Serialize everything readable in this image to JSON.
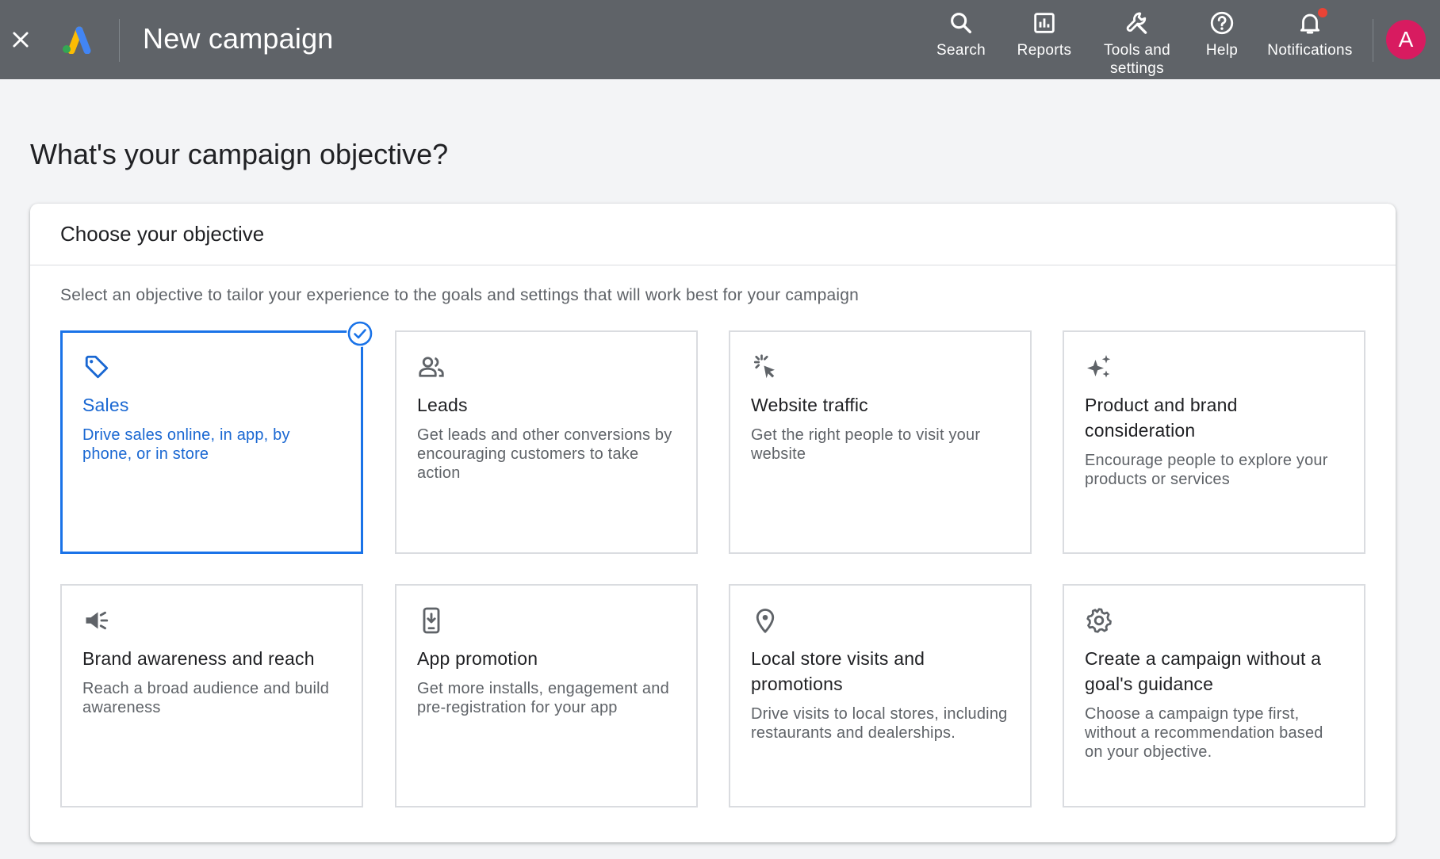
{
  "header": {
    "title": "New campaign",
    "nav": [
      {
        "label": "Search",
        "icon": "search-icon"
      },
      {
        "label": "Reports",
        "icon": "reports-icon"
      },
      {
        "label": "Tools and settings",
        "icon": "wrench-icon"
      },
      {
        "label": "Help",
        "icon": "help-icon"
      },
      {
        "label": "Notifications",
        "icon": "bell-icon"
      }
    ],
    "avatar": "A"
  },
  "page": {
    "title": "What's your campaign objective?",
    "panel_title": "Choose your objective",
    "panel_subtitle": "Select an objective to tailor your experience to the goals and settings that will work best for your campaign"
  },
  "objectives": [
    {
      "title": "Sales",
      "description": "Drive sales online, in app, by phone, or in store",
      "icon": "tag-icon",
      "selected": true
    },
    {
      "title": "Leads",
      "description": "Get leads and other conversions by encouraging customers to take action",
      "icon": "people-icon",
      "selected": false
    },
    {
      "title": "Website traffic",
      "description": "Get the right people to visit your website",
      "icon": "cursor-click-icon",
      "selected": false
    },
    {
      "title": "Product and brand consideration",
      "description": "Encourage people to explore your products or services",
      "icon": "sparkle-icon",
      "selected": false
    },
    {
      "title": "Brand awareness and reach",
      "description": "Reach a broad audience and build awareness",
      "icon": "megaphone-icon",
      "selected": false
    },
    {
      "title": "App promotion",
      "description": "Get more installs, engagement and pre-registration for your app",
      "icon": "phone-download-icon",
      "selected": false
    },
    {
      "title": "Local store visits and promotions",
      "description": "Drive visits to local stores, including restaurants and dealerships.",
      "icon": "location-pin-icon",
      "selected": false
    },
    {
      "title": "Create a campaign without a goal's guidance",
      "description": "Choose a campaign type first, without a recommendation based on your objective.",
      "icon": "gear-icon",
      "selected": false
    }
  ],
  "colors": {
    "topbar": "#5f6368",
    "accent": "#1a73e8",
    "avatar": "#d81b60"
  }
}
